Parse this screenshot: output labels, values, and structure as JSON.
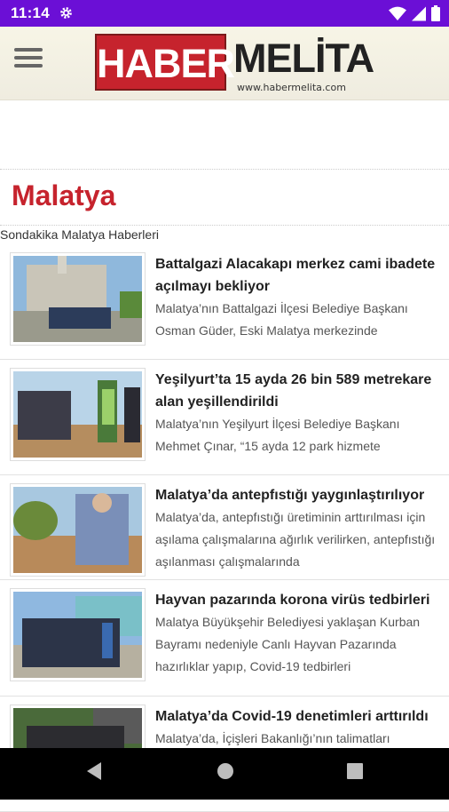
{
  "status_bar": {
    "time": "11:14",
    "icons": [
      "gear-icon",
      "wifi-icon",
      "signal-icon",
      "battery-icon"
    ]
  },
  "header": {
    "menu_icon": "menu-icon",
    "logo_left": "HABER",
    "logo_right": "MELİTA",
    "logo_url": "www.habermelita.com",
    "brand_color": "#c6232d"
  },
  "page": {
    "title": "Malatya",
    "subtitle": "Sondakika Malatya Haberleri"
  },
  "articles": [
    {
      "title": "Battalgazi Alacakapı merkez cami ibadete açılmayı bekliyor",
      "desc": "Malatya’nın Battalgazi İlçesi Belediye Başkanı Osman Güder, Eski Malatya merkezinde"
    },
    {
      "title": "Yeşilyurt’ta 15 ayda 26 bin 589 metrekare alan yeşillendirildi",
      "desc": "Malatya’nın Yeşilyurt İlçesi Belediye Başkanı Mehmet Çınar, “15 ayda 12 park hizmete"
    },
    {
      "title": "Malatya’da antepfıstığı yaygınlaştırılıyor",
      "desc": "Malatya’da, antepfıstığı üretiminin arttırılması için aşılama çalışmalarına ağırlık verilirken, antepfıstığı aşılanması çalışmalarında"
    },
    {
      "title": "Hayvan pazarında korona virüs tedbirleri",
      "desc": "Malatya Büyükşehir Belediyesi yaklaşan Kurban Bayramı nedeniyle Canlı Hayvan Pazarında hazırlıklar yapıp, Covid-19 tedbirleri"
    },
    {
      "title": "Malatya’da Covid-19 denetimleri arttırıldı",
      "desc": "Malatya’da, İçişleri Bakanlığı’nın talimatları"
    }
  ],
  "nav_bar": {
    "buttons": [
      "back-icon",
      "home-icon",
      "recents-icon"
    ]
  }
}
